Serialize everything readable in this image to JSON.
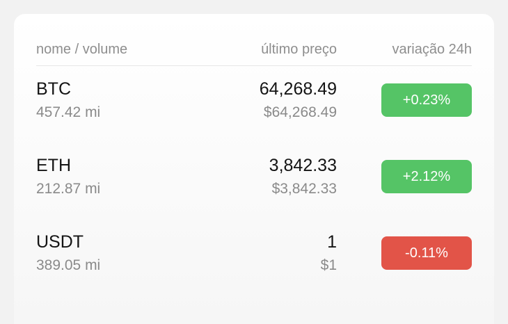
{
  "header": {
    "name_volume": "nome / volume",
    "last_price": "último preço",
    "change_24h": "variação 24h"
  },
  "colors": {
    "positive": "#55c466",
    "negative": "#e25448"
  },
  "rows": [
    {
      "symbol": "BTC",
      "volume": "457.42 mi",
      "price": "64,268.49",
      "fiat": "$64,268.49",
      "change": "+0.23%",
      "direction": "positive"
    },
    {
      "symbol": "ETH",
      "volume": "212.87 mi",
      "price": "3,842.33",
      "fiat": "$3,842.33",
      "change": "+2.12%",
      "direction": "positive"
    },
    {
      "symbol": "USDT",
      "volume": "389.05 mi",
      "price": "1",
      "fiat": "$1",
      "change": "-0.11%",
      "direction": "negative"
    }
  ]
}
